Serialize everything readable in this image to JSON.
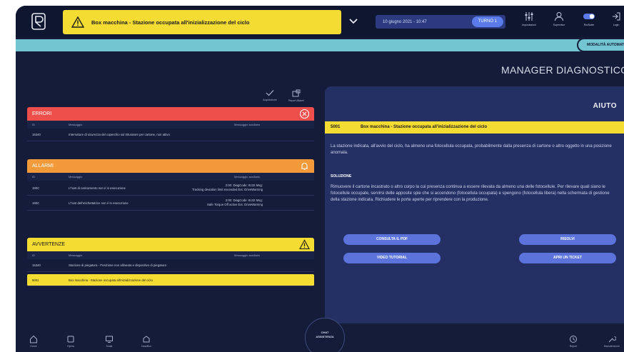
{
  "topbar": {
    "alert_text": "Box macchina - Stazione occupata all'inizializzazione del ciclo",
    "datetime": "10 giugno 2021 - 10:47",
    "turno": "TURNO 1",
    "buttons": [
      {
        "label": "Impostazioni",
        "icon": "sliders-icon"
      },
      {
        "label": "Supervisor",
        "icon": "user-icon"
      },
      {
        "label": "Ris/Notte",
        "icon": "toggle-icon"
      },
      {
        "label": "Login",
        "icon": "login-icon"
      }
    ]
  },
  "mode": "MODALITÀ AUTOMATICA",
  "page_title": "MANAGER DIAGNOSTICO",
  "toolbar": {
    "acquisizione": "Acquisizione",
    "report_allarmi": "Report Allarmi"
  },
  "errors": {
    "title": "ERRORI",
    "col_id": "ID",
    "col_msg": "Messaggio",
    "col_aux": "Messaggio ausiliario",
    "rows": [
      {
        "id": "15340",
        "msg": "Interruttore di sicurezza del coperchio sul trituratore per cartone, non attivo",
        "aux": ""
      }
    ]
  },
  "alarms": {
    "title": "ALLARMI",
    "col_id": "ID",
    "col_msg": "Messaggio",
    "col_aux": "Messaggio ausiliario",
    "rows": [
      {
        "id": "190C",
        "msg": "L'host di caricamento non è in esecuzione",
        "aux1": "2:00: DiagCode: 8132 Msg:",
        "aux2": "Tracking deviation limit exceeded Ext. DriveWarning"
      },
      {
        "id": "190C",
        "msg": "L'host dell'etichettatrice non è in esecuzione",
        "aux1": "2:00: DiagCode: 8132 Msg:",
        "aux2": "Safe Torque Off active Ext. DriveWarning"
      }
    ]
  },
  "warnings": {
    "title": "AVVERTENZE",
    "col_id": "ID",
    "col_msg": "Messaggio",
    "col_aux": "Messaggio ausiliario",
    "rows": [
      {
        "id": "15340",
        "msg": "Stazione di piegatura - Posizione non allineata e dispositivo di piegatura",
        "aux": ""
      },
      {
        "id": "5001",
        "msg": "Box macchina - Stazione occupata all'inizializzazione del ciclo",
        "aux": ""
      }
    ]
  },
  "help": {
    "title": "AIUTO",
    "code": "5001",
    "message": "Box macchina - Stazione occupata all'inizializzazione del ciclo",
    "description": "La stazione indicata, all'avvio del ciclo, ha almeno una fotocellula occupata, probabilmente dalla presenza di cartone o altro oggetto in una posizione anomala.",
    "solution_title": "SOLUZIONE",
    "solution": "Rimuovere il cartone incastrato o altro corpo la cui presenza continua a essere rilevata da almeno una delle fotocellule. Per rilevare quali siano le fotocellule occupate, servirsi delle apposite spie che si accendono (fotocellula occupata) e spengono (fotocellula libera) nella schermata di gestione della stazione indicata. Richiudere le porte aperte per riprendere con la produzione.",
    "btn_pdf": "CONSULTA IL PDF",
    "btn_video": "VIDEO TUTORIAL",
    "btn_risolvi": "RISOLVI",
    "btn_ticket": "APRI UN TICKET"
  },
  "bottom_nav": {
    "home": "Home",
    "opera": "Opera",
    "scala": "Scala",
    "caso": "CaseBox",
    "chat1": "CHAT",
    "chat2": "ASSISTENZA",
    "report": "Report",
    "manutenzione": "Manutenzione"
  },
  "colors": {
    "background": "#141c39",
    "error": "#ef4f4b",
    "alarm": "#f29a3a",
    "warning": "#f5dc32",
    "accent": "#5c73db",
    "mode": "#74c5d2"
  }
}
